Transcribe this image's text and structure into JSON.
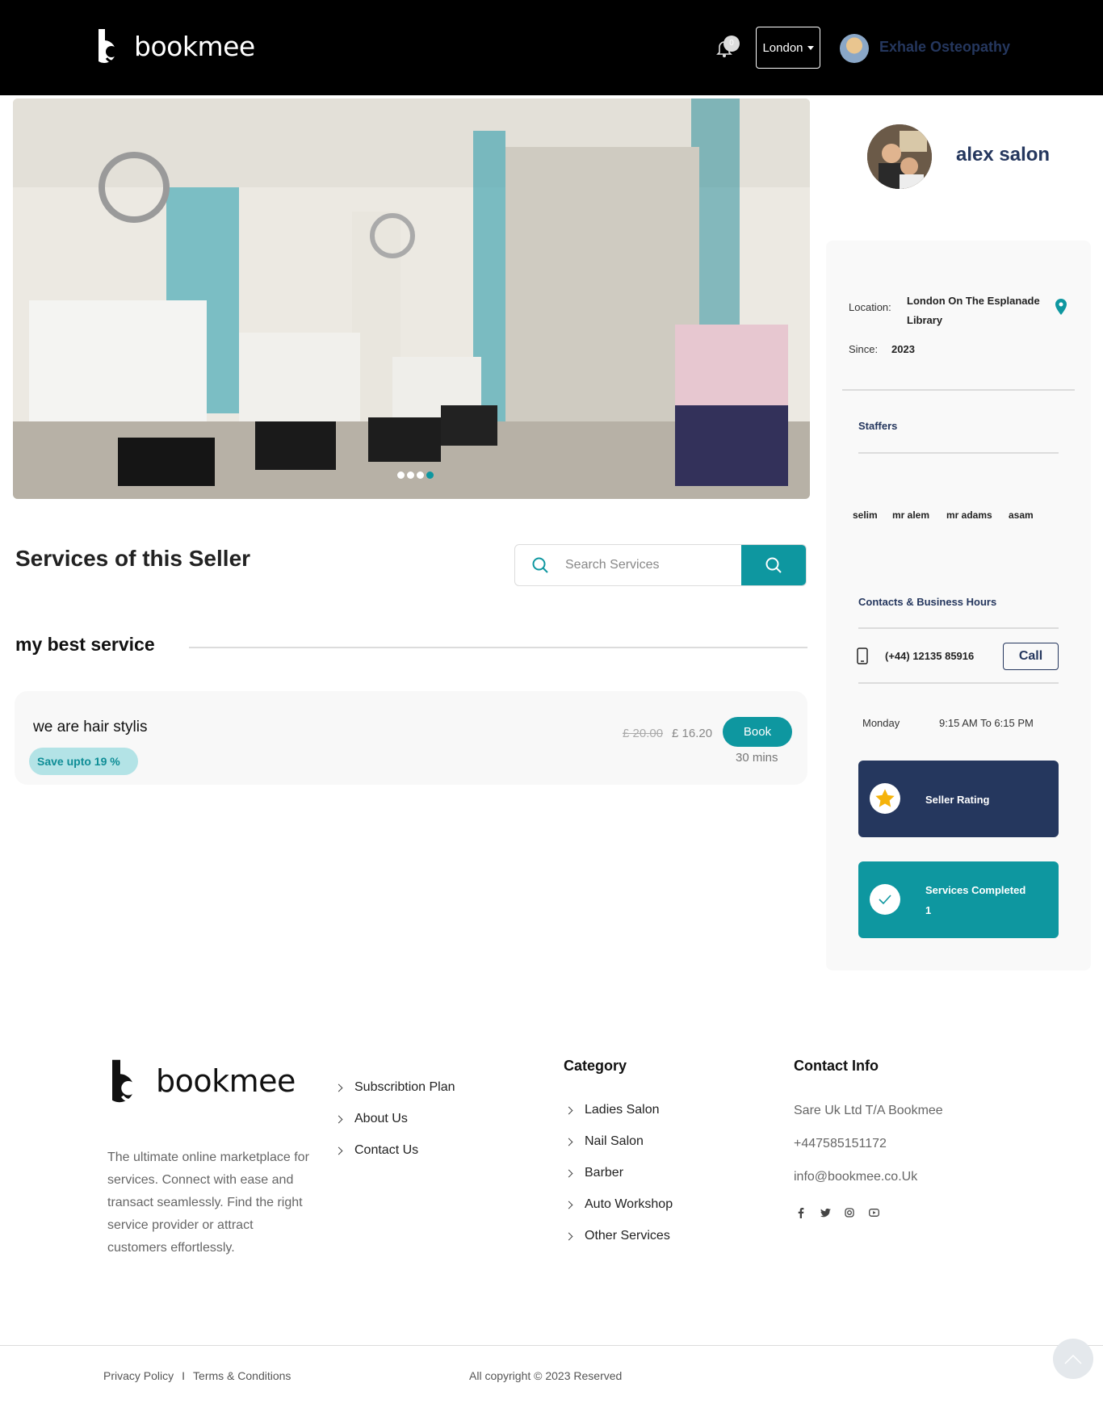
{
  "header": {
    "brand": "bookmee",
    "notification_count": "0",
    "city": "London",
    "user_name": "Exhale Osteopathy"
  },
  "hero": {
    "slide_count": 4,
    "active_slide": 4
  },
  "services": {
    "title": "Services of this Seller",
    "search_placeholder": "Search Services",
    "group_title": "my best service",
    "items": [
      {
        "name": "we are hair stylis",
        "save_badge": "Save upto 19 %",
        "old_price": "£ 20.00",
        "new_price": "£ 16.20",
        "book_label": "Book",
        "duration": "30 mins"
      }
    ]
  },
  "seller": {
    "name": "alex salon",
    "location_label": "Location:",
    "location_line1": "London On The Esplanade",
    "location_line2": "Library",
    "since_label": "Since:",
    "since_value": "2023",
    "staffers_title": "Staffers",
    "staffers": [
      "selim",
      "mr alem",
      "mr adams",
      "asam"
    ],
    "contacts_title": "Contacts & Business Hours",
    "phone": "(+44) 12135 85916",
    "call_label": "Call",
    "hours_day": "Monday",
    "hours_time": "9:15 AM To 6:15 PM",
    "rating_label": "Seller Rating",
    "completed_label": "Services Completed",
    "completed_count": "1"
  },
  "footer": {
    "brand": "bookmee",
    "description": "The ultimate online marketplace for services. Connect with ease and transact seamlessly. Find the right service provider or attract customers effortlessly.",
    "links": [
      "Subscribtion Plan",
      "About Us",
      "Contact Us"
    ],
    "category_title": "Category",
    "categories": [
      "Ladies Salon",
      "Nail Salon",
      "Barber",
      "Auto Workshop",
      "Other Services"
    ],
    "contact_title": "Contact Info",
    "company": "Sare Uk Ltd T/A Bookmee",
    "phone": "+447585151172",
    "email": "info@bookmee.co.Uk",
    "socials": [
      "facebook-icon",
      "twitter-icon",
      "instagram-icon",
      "youtube-icon"
    ],
    "privacy": "Privacy Policy",
    "separator": "I",
    "terms": "Terms & Conditions",
    "copyright": "All copyright © 2023 Reserved"
  },
  "colors": {
    "teal": "#0e97a0",
    "navy": "#25375e",
    "header_bg": "#000000"
  }
}
